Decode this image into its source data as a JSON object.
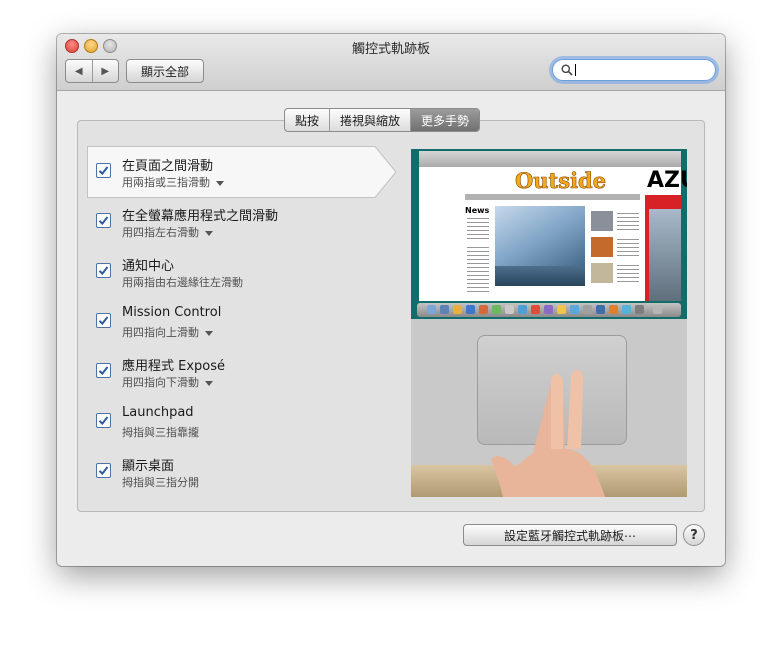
{
  "window": {
    "title": "觸控式軌跡板"
  },
  "toolbar": {
    "back_label": "◀",
    "forward_label": "▶",
    "show_all_label": "顯示全部",
    "search_value": ""
  },
  "tabs": [
    {
      "label": "點按",
      "active": false
    },
    {
      "label": "捲視與縮放",
      "active": false
    },
    {
      "label": "更多手勢",
      "active": true
    }
  ],
  "gestures": [
    {
      "name": "在頁面之間滑動",
      "detail": "用兩指或三指滑動",
      "checked": true,
      "has_menu": true,
      "selected": true
    },
    {
      "name": "在全螢幕應用程式之間滑動",
      "detail": "用四指左右滑動",
      "checked": true,
      "has_menu": true,
      "selected": false
    },
    {
      "name": "通知中心",
      "detail": "用兩指由右邊緣往左滑動",
      "checked": true,
      "has_menu": false,
      "selected": false
    },
    {
      "name": "Mission Control",
      "detail": "用四指向上滑動",
      "checked": true,
      "has_menu": true,
      "selected": false
    },
    {
      "name": "應用程式 Exposé",
      "detail": "用四指向下滑動",
      "checked": true,
      "has_menu": true,
      "selected": false
    },
    {
      "name": "Launchpad",
      "detail": "拇指與三指靠攏",
      "checked": true,
      "has_menu": false,
      "selected": false
    },
    {
      "name": "顯示桌面",
      "detail": "拇指與三指分開",
      "checked": true,
      "has_menu": false,
      "selected": false
    }
  ],
  "preview": {
    "site_logo": "Outside",
    "news_heading": "News",
    "side_headline": "AZU"
  },
  "footer": {
    "bluetooth_button_label": "設定藍牙觸控式軌跡板⋯",
    "help_label": "?"
  },
  "colors": {
    "accent_checkbox": "#4c73a8",
    "active_tab": "#808080",
    "search_focus": "#6e9ee0"
  }
}
